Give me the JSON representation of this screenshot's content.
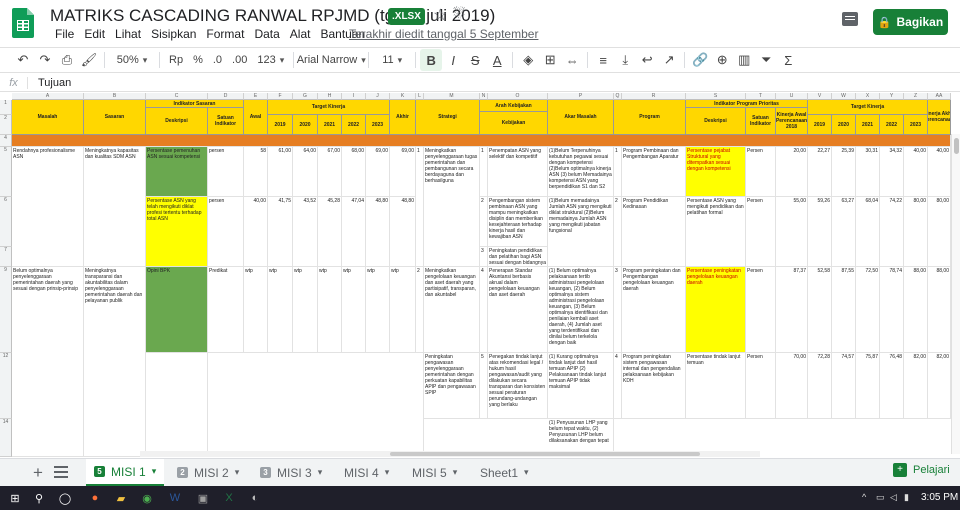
{
  "doc": {
    "title": "MATRIKS CASCADING RANWAL RPJMD (tgl 10 juli 2019)",
    "badge": ".XLSX",
    "menus": [
      "File",
      "Edit",
      "Lihat",
      "Sisipkan",
      "Format",
      "Data",
      "Alat",
      "Bantuan"
    ],
    "last_edit": "Terakhir diedit tanggal 5 September",
    "share_label": "Bagikan"
  },
  "toolbar": {
    "zoom": "50%",
    "currency": "Rp",
    "percent": "%",
    "dec_less": ".0",
    "dec_more": ".00",
    "format_more": "123",
    "font": "Arial Narrow",
    "font_size": "11"
  },
  "formula": {
    "fx": "fx",
    "value": "Tujuan"
  },
  "grid": {
    "col_letters": [
      "A",
      "B",
      "C",
      "D",
      "E",
      "F",
      "G",
      "H",
      "I",
      "J",
      "K",
      "L",
      "M",
      "N",
      "O",
      "P",
      "Q",
      "R",
      "S",
      "T",
      "U",
      "V",
      "W",
      "X",
      "Y",
      "Z",
      "AA",
      "AB",
      "AC"
    ],
    "headers": {
      "masalah": "Masalah",
      "sasaran": "Sasaran",
      "indikator_sasaran": "Indikator Sasaran",
      "deskripsi": "Deskripsi",
      "satuan": "Satuan Indikator",
      "awal": "Awal",
      "target_kinerja": "Target Kinerja",
      "years": [
        "2019",
        "2020",
        "2021",
        "2022",
        "2023"
      ],
      "akhir": "Akhir",
      "strategi": "Strategi",
      "arah": "Arah Kebijakan",
      "kebijakan": "Kebijakan",
      "akar": "Akar Masalah",
      "program": "Program",
      "ind_prog": "Indikator Program Prioritas",
      "deskripsi2": "Deskripsi",
      "satuan2": "Satuan Indikator",
      "kinerja_awal": "Kinerja Awal Perencanaan 2018",
      "target_kinerja2": "Target Kinerja",
      "kinerja_akhir": "Kinerja Akhir Perencanaan"
    },
    "rows": {
      "r1_masalah": "Rendahnya profesionalisme ASN",
      "r1_sasaran": "Meningkatnya kapasitas dan kualitas SDM ASN",
      "r1_ind": "Persentase pemenuhan ASN sesuai kompetensi",
      "r1_satuan": "persen",
      "r1_vals": [
        "58",
        "61,00",
        "64,00",
        "67,00",
        "68,00",
        "69,00",
        "69,00"
      ],
      "r1_strategi": "Meningkatkan penyelenggaraan tugas pemerintahan dan pembangunan secara berdayaguna dan berhasilguna",
      "r1_keb": "Penempatan ASN yang selektif dan kompetitif",
      "r1_akar": "(1)Belum Terpenuhinya kebutuhan pegawai sesuai dengan kompetensi (2)Belum optimalnya kinerja ASN (3) belum Memadainya kompetensi ASN yang berpendidikan S1 dan S2",
      "r1_prog": "Program Pembinaan dan Pengembangan Aparatur",
      "r1_ind2": "Persentase pejabat Struktural yang ditempatkan sesuai dengan kompetensi",
      "r1_sat2": "Persen",
      "r1_vals2": [
        "20,00",
        "22,27",
        "25,39",
        "30,31",
        "34,32",
        "40,00",
        "40,00"
      ],
      "r2_ind": "Persentase ASN yang telah mengikuti diklat profesi tertentu terhadap total ASN",
      "r2_satuan": "persen",
      "r2_vals": [
        "40,00",
        "41,75",
        "43,52",
        "45,28",
        "47,04",
        "48,80",
        "48,80"
      ],
      "r2_keb": "Pengembangan sistem pembinaan ASN yang mampu meningkatkan disiplin dan memberikan kesejahteraan terhadap kinerja hasil dan kewajiban ASN",
      "r2_akar": "(1)Belum memadainya Jumlah ASN yang mengikuti diklat struktural (2)Belum memadainya Jumlah ASN yang mengikuti jabatan fungsional",
      "r2_prog": "Program Pendidikan Kedinasan",
      "r2_ind2": "Persentase ASN yang mengikuti pendidikan dan pelatihan formal",
      "r2_sat2": "Persen",
      "r2_vals2": [
        "55,00",
        "59,26",
        "63,27",
        "68,04",
        "74,22",
        "80,00",
        "80,00"
      ],
      "r3_num": "3",
      "r3_keb": "Peningkatan pendidikan dan pelatihan bagi ASN sesuai dengan bidangnya",
      "r4_masalah": "Belum optimalnya penyelenggaraan pemerintahan daerah yang sesuai dengan prinsip-prinsip",
      "r4_sasaran": "Meningkatnya transparansi dan akuntabilitas dalam penyelenggaraan pemerintahan daerah dan pelayanan publik",
      "r4_ind": "Opini BPK",
      "r4_satuan": "Predikat",
      "r4_vals": [
        "wtp",
        "wtp",
        "wtp",
        "wtp",
        "wtp",
        "wtp",
        "wtp"
      ],
      "r4_num": "2",
      "r4_strategi": "Meningkatkan pengelolaan keuangan dan aset daerah yang partisipatif, transparan, dan akuntabel",
      "r4_num2": "4",
      "r4_keb": "Penerapan Standar Akuntansi berbasis akrual dalam pengelolaan keuangan dan aset daerah",
      "r4_akar": "(1) Belum optimalnya pelaksanaan tertib administrasi pengelolaan keuangan, (2) Belum optimalnya sistem administrasi pengelolaan keuangan, (3) Belum optimalnya identifikasi dan penilaian kembali aset daerah, (4) Jumlah aset yang terdentifikasi dan dinilai belum terkelola dengan baik",
      "r4_num3": "3",
      "r4_prog": "Program peningkatan dan Pengembangan pengelolaan keuangan daerah",
      "r4_ind2": "Persentase peningkatan pengelolaan keuangan daerah",
      "r4_sat2": "Persen",
      "r4_vals2": [
        "87,37",
        "52,58",
        "87,55",
        "72,50",
        "78,74",
        "88,00",
        "88,00"
      ],
      "r5_strategi": "Peningkatan pengawasan penyelenggaraan pemerintahan dengan perkuatan kapabilitas APIP dan pengawasan SPIP",
      "r5_num": "5",
      "r5_keb": "Penegakan tindak lanjut atas rekomendasi legal / hukum hasil pengawasan/audit yang dilakukan secara transparan dan konsisten sesuai peraturan perundang-undangan yang berlaku",
      "r5_akar": "(1) Kurang optimalnya tindak lanjut dari hasil temuan APIP (2) Pelaksanaan tindak lanjut temuan APIP tidak maksimal",
      "r5_num2": "4",
      "r5_prog": "Program peningkatan sistem pengawasan internal dan pengendalian pelaksanaan kebijakan KDH",
      "r5_ind2": "Persentase tindak lanjut temuan",
      "r5_sat2": "Persen",
      "r5_vals2": [
        "70,00",
        "72,28",
        "74,57",
        "75,87",
        "76,48",
        "82,00",
        "82,00"
      ],
      "r6_akar": "(1) Penyusunan LHP yang belum tepat waktu, (2) Penyusunan LHP belum dilaksanakan dengan tepat"
    }
  },
  "tabs": {
    "items": [
      {
        "label": "MISI 1",
        "color": "#188038"
      },
      {
        "label": "MISI 2",
        "color": "#5f6368"
      },
      {
        "label": "MISI 3",
        "color": "#5f6368"
      },
      {
        "label": "MISI 4",
        "color": "#5f6368"
      },
      {
        "label": "MISI 5",
        "color": "#5f6368"
      },
      {
        "label": "Sheet1",
        "color": "#5f6368"
      }
    ],
    "explore_label": "Pelajari"
  },
  "taskbar": {
    "time": "3:05 PM"
  },
  "colors": {
    "accent": "#188038",
    "header_yellow": "#ffd700",
    "band_orange": "#e67e22",
    "highlight_yellow": "#ffff00",
    "highlight_green": "#6aa84f"
  }
}
